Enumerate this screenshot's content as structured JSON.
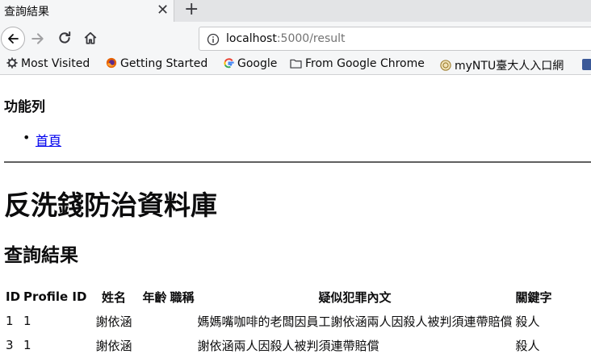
{
  "browser": {
    "tab_title": "查詢結果",
    "url_host": "localhost",
    "url_rest": ":5000/result",
    "bookmarks": [
      {
        "label": "Most Visited",
        "icon": "gear-icon"
      },
      {
        "label": "Getting Started",
        "icon": "firefox-icon"
      },
      {
        "label": "Google",
        "icon": "google-icon"
      },
      {
        "label": "From Google Chrome",
        "icon": "folder-icon"
      },
      {
        "label": "myNTU臺大人入口網",
        "icon": "ntu-seal-icon"
      }
    ]
  },
  "page": {
    "nav_heading": "功能列",
    "nav_links": [
      {
        "label": "首頁"
      }
    ],
    "site_title": "反洗錢防治資料庫",
    "section_title": "查詢結果",
    "table": {
      "headers": [
        "ID",
        "Profile ID",
        "姓名",
        "年齡",
        "職稱",
        "疑似犯罪內文",
        "關鍵字"
      ],
      "rows": [
        [
          "1",
          "1",
          "謝依涵",
          "",
          "",
          "媽媽嘴咖啡的老闆因員工謝依涵兩人因殺人被判須連帶賠償",
          "殺人"
        ],
        [
          "3",
          "1",
          "謝依涵",
          "",
          "",
          "謝依涵兩人因殺人被判須連帶賠償",
          "殺人"
        ]
      ]
    }
  }
}
